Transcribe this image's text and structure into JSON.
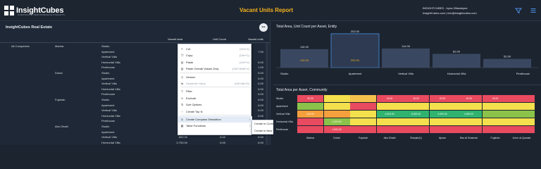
{
  "header": {
    "logo_text": "InsightCubes",
    "logo_tagline": "CORPORATE PERFORMANCE INSIGHTS",
    "report_title": "Vacant  Units Report",
    "user_line1": "INSIGHTCUBES - Iryna Zilianskyne",
    "user_line2": "InsightCubes.com | info@insightcubes.com",
    "filter_icon": "filter-icon",
    "menu_icon": "hamburger-icon"
  },
  "left_panel": {
    "title": "InsightCubes Real Estate",
    "more_label": "•••",
    "columns": [
      "Vacant area",
      "Unit Count",
      "Vacant units"
    ],
    "rows": [
      {
        "company": "All Companies",
        "community": "Marina",
        "asset": "Studio",
        "v1": "",
        "v2": "",
        "v3": ""
      },
      {
        "company": "",
        "community": "",
        "asset": "Apartment",
        "v1": "",
        "v2": "",
        "v3": "7.00"
      },
      {
        "company": "",
        "community": "",
        "asset": "Vertical Villa",
        "v1": "",
        "v2": "",
        "v3": ""
      },
      {
        "company": "",
        "community": "",
        "asset": "Horizontal Villa",
        "v1": "",
        "v2": "",
        "v3": "6.00"
      },
      {
        "company": "",
        "community": "",
        "asset": "Penthouse",
        "v1": "",
        "v2": "",
        "v3": "1.00"
      },
      {
        "company": "",
        "community": "Dubai",
        "asset": "Studio",
        "v1": "",
        "v2": "",
        "v3": "6.00"
      },
      {
        "company": "",
        "community": "",
        "asset": "Apartment",
        "v1": "",
        "v2": "",
        "v3": "6.00"
      },
      {
        "company": "",
        "community": "",
        "asset": "Vertical Villa",
        "v1": "",
        "v2": "",
        "v3": "6.00"
      },
      {
        "company": "",
        "community": "",
        "asset": "Horizontal Villa",
        "v1": "",
        "v2": "",
        "v3": "6.00"
      },
      {
        "company": "",
        "community": "",
        "asset": "Penthouse",
        "v1": "",
        "v2": "",
        "v3": "6.00"
      },
      {
        "company": "",
        "community": "Fujairah",
        "asset": "Studio",
        "v1": "",
        "v2": "",
        "v3": "6.00"
      },
      {
        "company": "",
        "community": "",
        "asset": "Apartment",
        "v1": "",
        "v2": "",
        "v3": "6.00"
      },
      {
        "company": "",
        "community": "",
        "asset": "Vertical Villa",
        "v1": "",
        "v2": "",
        "v3": "6.00"
      },
      {
        "company": "",
        "community": "",
        "asset": "Horizontal Villa",
        "v1": "",
        "v2": "",
        "v3": "6.00"
      },
      {
        "company": "",
        "community": "",
        "asset": "Penthouse",
        "v1": "",
        "v2": "",
        "v3": "6.00"
      },
      {
        "company": "",
        "community": "Abu Dhabi",
        "asset": "Studio",
        "v1": "",
        "v2": "",
        "v3": "6.00"
      },
      {
        "company": "",
        "community": "",
        "asset": "Apartment",
        "v1": "",
        "v2": "",
        "v3": "6.00"
      },
      {
        "company": "",
        "community": "",
        "asset": "Vertical Villa",
        "v1": "800.00",
        "v2": "6.00",
        "v3": "6.00"
      },
      {
        "company": "",
        "community": "",
        "asset": "Horizontal Villa",
        "v1": "2,700.00",
        "v2": "6.00",
        "v3": "6.00"
      }
    ]
  },
  "context_menu": {
    "items": [
      {
        "icon": "scissors-icon",
        "glyph": "✂",
        "label": "Cut",
        "shortcut": "(Ctrl+X)",
        "disabled": false
      },
      {
        "icon": "copy-icon",
        "glyph": "❐",
        "label": "Copy",
        "shortcut": "(Ctrl+C)",
        "disabled": false
      },
      {
        "icon": "paste-icon",
        "glyph": "▤",
        "label": "Paste",
        "shortcut": "(Ctrl+V)",
        "disabled": false
      },
      {
        "icon": "paste-values-icon",
        "glyph": "▤",
        "label": "Paste Overall Values Only",
        "shortcut": "(Ctrl+Shift+V)",
        "disabled": false
      },
      {
        "icon": "version-icon",
        "glyph": "◷",
        "label": "Version",
        "shortcut": "",
        "disabled": false
      },
      {
        "icon": "distribute-icon",
        "glyph": "⇆",
        "label": "Distribute Value",
        "shortcut": "(Ctrl+Alt+D)",
        "disabled": true
      },
      {
        "icon": "filter-icon",
        "glyph": "▽",
        "label": "Filter",
        "shortcut": "",
        "disabled": false
      },
      {
        "icon": "exclude-icon",
        "glyph": "✕",
        "label": "Exclude",
        "shortcut": "",
        "disabled": false
      },
      {
        "icon": "sort-icon",
        "glyph": "⇅",
        "label": "Sort Options",
        "shortcut": "",
        "disabled": false
      },
      {
        "icon": "top-n-icon",
        "glyph": "↑",
        "label": "Create Top N",
        "shortcut": "",
        "disabled": false
      },
      {
        "icon": "compass-icon",
        "glyph": "◎",
        "label": "Create Compass Simulation",
        "shortcut": "",
        "disabled": false,
        "has_sub": true
      },
      {
        "icon": "table-icon",
        "glyph": "▦",
        "label": "Table Functions",
        "shortcut": "",
        "disabled": false,
        "has_sub": true
      }
    ],
    "sub_items": [
      "Create in Current Tab",
      "Create in New Tab"
    ]
  },
  "chart_top": {
    "title": "Total Area, Unit Count per Asset, Entity"
  },
  "chart_bottom": {
    "title": "Total Area per Asset, Community"
  },
  "chart_data": [
    {
      "type": "bar",
      "title": "Total Area, Unit Count per Asset, Entity",
      "categories": [
        "Studio",
        "Apartment",
        "Vertical Villa",
        "Horizontal Villa",
        "Penthouse"
      ],
      "series": [
        {
          "values": [
            110,
            202,
            114,
            82,
            52
          ]
        }
      ],
      "data_labels": [
        "110.00",
        "202.00",
        "114.00",
        "82.00",
        "52.00"
      ],
      "inner_labels": [
        "110.00",
        "202.00"
      ],
      "ylim": [
        0,
        210
      ]
    },
    {
      "type": "heatmap",
      "title": "Total Area per Asset, Community",
      "rows": [
        "Studio",
        "Apartment",
        "Vertical Villa",
        "Horizontal Villa",
        "Penthouse"
      ],
      "columns": [
        "Marina",
        "Dubai",
        "Fujairah",
        "Abu Dhabi",
        "Sharjah(1)",
        "Ajman",
        "Ras Al Khaimah",
        "Fujairah",
        "Umm al-Quwain"
      ],
      "cells": [
        [
          {
            "v": "20.00",
            "c": "#e84a5f"
          },
          {
            "v": "",
            "c": "#f4e04d"
          },
          {
            "v": "",
            "c": "#f5c14d"
          },
          {
            "v": "15.00",
            "c": "#e84a5f"
          },
          {
            "v": "15.00",
            "c": "#e84a5f"
          },
          {
            "v": "20.00",
            "c": "#e84a5f"
          },
          {
            "v": "15.00",
            "c": "#e84a5f"
          },
          {
            "v": "20.00",
            "c": "#e84a5f"
          },
          {
            "v": "",
            "c": "#e84a5f"
          }
        ],
        [
          {
            "v": "",
            "c": "#8bc34a"
          },
          {
            "v": "",
            "c": "#f4e04d"
          },
          {
            "v": "",
            "c": "#e84a5f"
          },
          {
            "v": "",
            "c": "#f4e04d"
          },
          {
            "v": "",
            "c": "#f4e04d"
          },
          {
            "v": "",
            "c": "#f4e04d"
          },
          {
            "v": "",
            "c": "#f4e04d"
          },
          {
            "v": "",
            "c": "#f4e04d"
          },
          {
            "v": "",
            "c": "#f4e04d"
          }
        ],
        [
          {
            "v": "410.00",
            "c": "#f5a03c"
          },
          {
            "v": "",
            "c": "#f5a03c"
          },
          {
            "v": "",
            "c": "#f4e04d"
          },
          {
            "v": "4,000.00",
            "c": "#2fb36f"
          },
          {
            "v": "8,000.00",
            "c": "#2fb36f"
          },
          {
            "v": "4,000.00",
            "c": "#2fb36f"
          },
          {
            "v": "4,000.00",
            "c": "#2fb36f"
          },
          {
            "v": "",
            "c": "#8bc34a"
          },
          {
            "v": "",
            "c": "#8bc34a"
          }
        ],
        [
          {
            "v": "",
            "c": "#e84a5f"
          },
          {
            "v": "1,200.00",
            "c": "#8bc34a"
          },
          {
            "v": "",
            "c": "#f4e04d"
          },
          {
            "v": "",
            "c": "#f4e04d"
          },
          {
            "v": "",
            "c": "#f4e04d"
          },
          {
            "v": "",
            "c": "#f4e04d"
          },
          {
            "v": "",
            "c": "#f4e04d"
          },
          {
            "v": "",
            "c": "#f4e04d"
          },
          {
            "v": "",
            "c": "#f4e04d"
          }
        ],
        [
          {
            "v": "",
            "c": "#e84a5f"
          },
          {
            "v": "1,000.00",
            "c": "#e84a5f"
          },
          {
            "v": "",
            "c": "#e84a5f"
          },
          {
            "v": "",
            "c": "#e84a5f"
          },
          {
            "v": "",
            "c": "#e84a5f"
          },
          {
            "v": "",
            "c": "#e84a5f"
          },
          {
            "v": "",
            "c": "#e84a5f"
          },
          {
            "v": "",
            "c": "#e84a5f"
          },
          {
            "v": "",
            "c": "#e84a5f"
          }
        ]
      ]
    }
  ],
  "colors": {
    "accent": "#f5b31b",
    "bar_fill": "#3a4760",
    "bar_fill_selected": "#2d3a52",
    "bar_outline_selected": "#4a90e2",
    "inner_label": "#f5b31b"
  }
}
